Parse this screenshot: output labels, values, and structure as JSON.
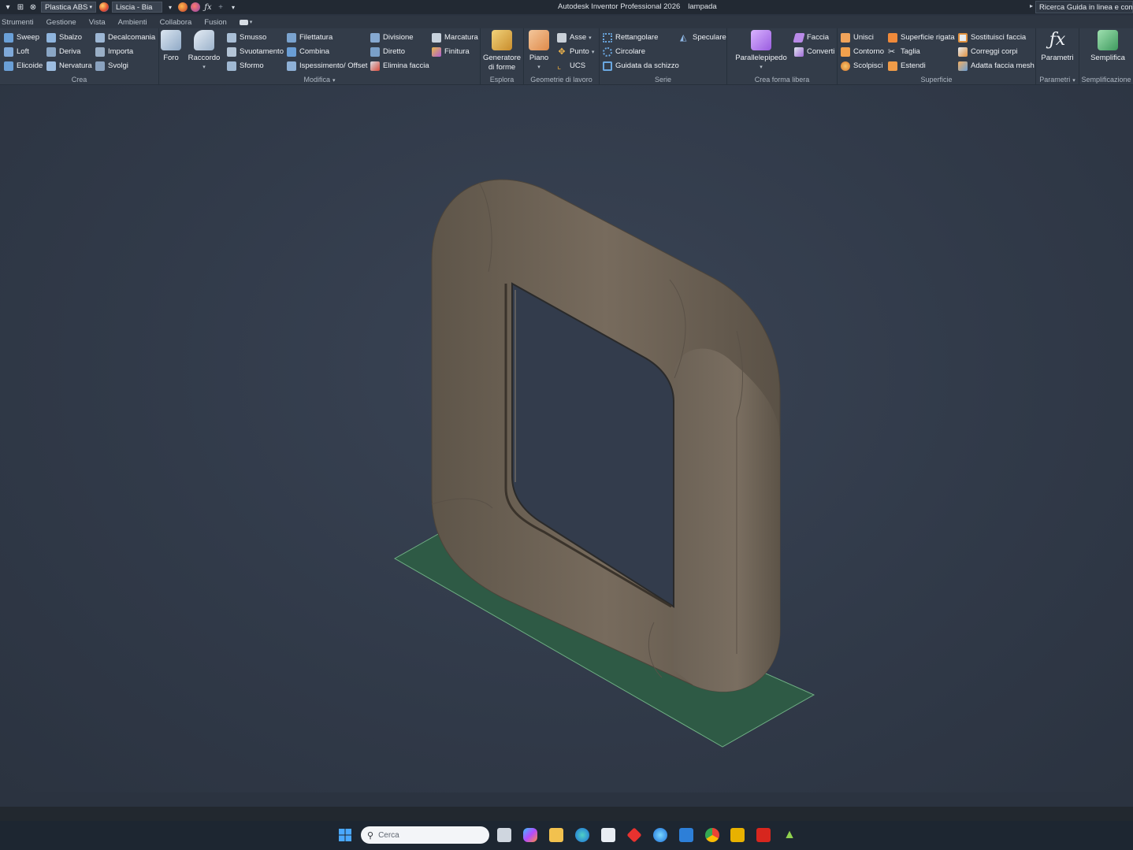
{
  "titlebar": {
    "material": "Plastica ABS",
    "appearance": "Liscia - Bia",
    "app_title": "Autodesk Inventor Professional 2026",
    "document": "lampada",
    "help_search": "Ricerca Guida in linea e comandi"
  },
  "tabs": [
    "Strumenti",
    "Gestione",
    "Vista",
    "Ambienti",
    "Collabora",
    "Fusion"
  ],
  "ribbon": {
    "crea": {
      "label": "Crea",
      "items": [
        "Sweep",
        "Sbalzo",
        "Decalcomania",
        "Loft",
        "Deriva",
        "Importa",
        "Elicoide",
        "Nervatura",
        "Svolgi"
      ]
    },
    "foro": "Foro",
    "raccordo": "Raccordo",
    "modifica": {
      "label": "Modifica",
      "items": [
        "Smusso",
        "Filettatura",
        "Divisione",
        "Marcatura",
        "Svuotamento",
        "Combina",
        "Diretto",
        "Finitura",
        "Sformo",
        "Ispessimento/ Offset",
        "Elimina faccia"
      ]
    },
    "esplora": {
      "label": "Esplora",
      "button_line1": "Generatore",
      "button_line2": "di forme"
    },
    "geometrie": {
      "label": "Geometrie di lavoro",
      "piano": "Piano",
      "items": [
        "Asse",
        "Punto",
        "UCS"
      ]
    },
    "serie": {
      "label": "Serie",
      "items": [
        "Rettangolare",
        "Speculare",
        "Circolare",
        "Guidata da schizzo"
      ]
    },
    "forma_libera": {
      "label": "Crea forma libera",
      "parallelepipedo": "Parallelepipedo",
      "items": [
        "Faccia",
        "Converti"
      ]
    },
    "superficie": {
      "label": "Superficie",
      "items": [
        "Unisci",
        "Superficie rigata",
        "Sostituisci faccia",
        "Contorno",
        "Taglia",
        "Correggi corpi",
        "Scolpisci",
        "Estendi",
        "Adatta faccia mesh"
      ]
    },
    "parametri": {
      "label": "Parametri",
      "button": "Parametri"
    },
    "semplificazione": {
      "label": "Semplificazione",
      "button": "Semplifica"
    }
  },
  "taskbar": {
    "search_placeholder": "Cerca"
  },
  "colors": {
    "model": "#6f6457",
    "ground": "#2e5a45",
    "accent": "#e8b100"
  }
}
